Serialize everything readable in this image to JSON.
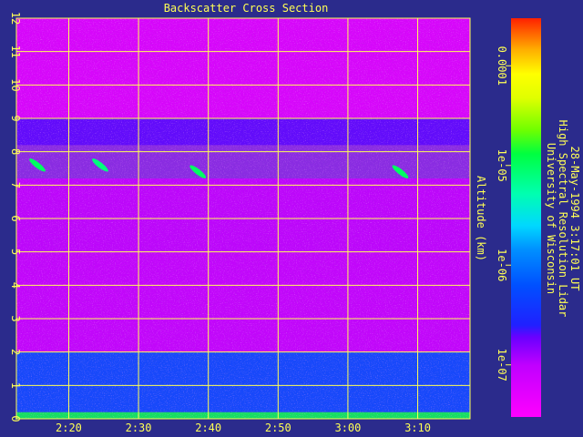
{
  "chart_data": {
    "type": "heatmap",
    "title": "Backscatter Cross Section",
    "ylabel": "Altitude (km)",
    "xlabel": "",
    "x_ticks": [
      "2:20",
      "2:30",
      "2:40",
      "2:50",
      "3:00",
      "3:10"
    ],
    "x_tick_minutes": [
      140,
      150,
      160,
      170,
      180,
      190
    ],
    "xlim_minutes": [
      132.5,
      197.5
    ],
    "y_ticks": [
      0,
      1,
      2,
      3,
      4,
      5,
      6,
      7,
      8,
      9,
      10,
      11,
      12
    ],
    "ylim": [
      0,
      12
    ],
    "grid": true,
    "colorbar": {
      "scale": "log",
      "range": [
        3e-08,
        0.0003
      ],
      "tick_labels": [
        "1e-07",
        "1e-06",
        "1e-05",
        "0.0001"
      ],
      "tick_values": [
        1e-07,
        1e-06,
        1e-05,
        0.0001
      ]
    },
    "layers": [
      {
        "alt_min": 0,
        "alt_max": 0.2,
        "level": 1.2e-05
      },
      {
        "alt_min": 0.2,
        "alt_max": 2.0,
        "level": 6e-07
      },
      {
        "alt_min": 2.0,
        "alt_max": 5.0,
        "level": 8e-08
      },
      {
        "alt_min": 5.0,
        "alt_max": 7.2,
        "level": 9e-08
      },
      {
        "alt_min": 8.2,
        "alt_max": 9.0,
        "level": 2e-07
      },
      {
        "alt_min": 9.0,
        "alt_max": 12.0,
        "level": 5e-08
      }
    ],
    "features": [
      {
        "time_minutes": 135.5,
        "altitude_km": 7.6,
        "level": 1e-05
      },
      {
        "time_minutes": 144.5,
        "altitude_km": 7.6,
        "level": 8e-06
      },
      {
        "time_minutes": 158.5,
        "altitude_km": 7.4,
        "level": 1e-05
      },
      {
        "time_minutes": 187.5,
        "altitude_km": 7.4,
        "level": 1e-05
      }
    ]
  },
  "caption": {
    "line1": "University of Wisconsin",
    "line2": "High Spectral Resolution Lidar",
    "line3": "28-May-1994 3:17:01 UT"
  },
  "colors": {
    "background": "#2b2b8c",
    "axis": "#ffff55",
    "plot_base": "#8a2be2"
  }
}
